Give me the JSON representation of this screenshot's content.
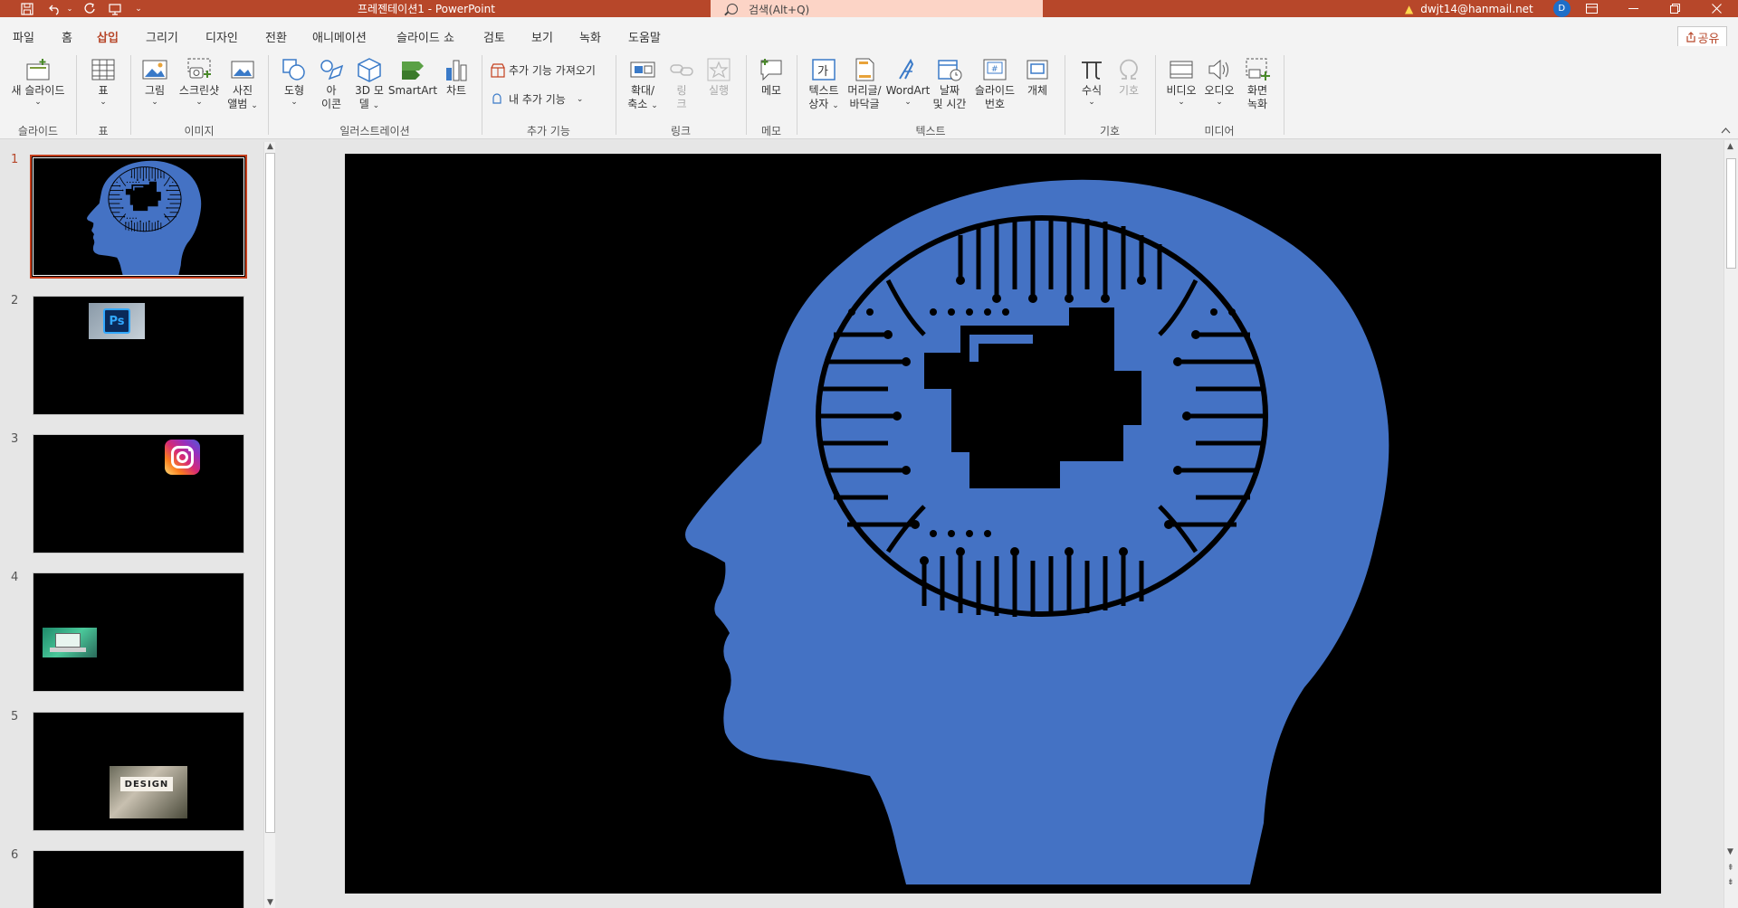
{
  "window": {
    "title": "프레젠테이션1  -  PowerPoint",
    "search_placeholder": "검색(Alt+Q)",
    "user_email": "dwjt14@hanmail.net",
    "avatar_initial": "D",
    "accent_color": "#b7472a"
  },
  "tabs": [
    {
      "label": "파일"
    },
    {
      "label": "홈"
    },
    {
      "label": "삽입",
      "active": true
    },
    {
      "label": "그리기"
    },
    {
      "label": "디자인"
    },
    {
      "label": "전환"
    },
    {
      "label": "애니메이션"
    },
    {
      "label": "슬라이드 쇼"
    },
    {
      "label": "검토"
    },
    {
      "label": "보기"
    },
    {
      "label": "녹화"
    },
    {
      "label": "도움말"
    }
  ],
  "share_label": "공유",
  "ribbon": {
    "groups": {
      "slides": "슬라이드",
      "table": "표",
      "images": "이미지",
      "illustrations": "일러스트레이션",
      "addins": "추가 기능",
      "links": "링크",
      "comments": "메모",
      "text": "텍스트",
      "symbols": "기호",
      "media": "미디어"
    },
    "buttons": {
      "new_slide": "새 슬라이드",
      "table": "표",
      "picture": "그림",
      "screenshot": "스크린샷",
      "photo_album_1": "사진",
      "photo_album_2": "앨범",
      "shapes": "도형",
      "icons_1": "아",
      "icons_2": "이콘",
      "model3d_1": "3D 모",
      "model3d_2": "델",
      "smartart": "SmartArt",
      "chart": "차트",
      "get_addins": "추가 기능 가져오기",
      "my_addins": "내 추가 기능",
      "zoom_1": "확대/",
      "zoom_2": "축소",
      "link_1": "링",
      "link_2": "크",
      "action": "실행",
      "comment": "메모",
      "textbox_1": "텍스트",
      "textbox_2": "상자",
      "header_1": "머리글/",
      "header_2": "바닥글",
      "wordart": "WordArt",
      "datetime_1": "날짜",
      "datetime_2": "및 시간",
      "slidenum_1": "슬라이드",
      "slidenum_2": "번호",
      "object": "개체",
      "equation": "수식",
      "symbol": "기호",
      "video": "비디오",
      "audio": "오디오",
      "screenrec_1": "화면",
      "screenrec_2": "녹화"
    }
  },
  "slides": [
    {
      "num": "1",
      "selected": true,
      "content": "head-circuit"
    },
    {
      "num": "2",
      "content": "photoshop-logo"
    },
    {
      "num": "3",
      "content": "instagram-logo"
    },
    {
      "num": "4",
      "content": "laptop-photo"
    },
    {
      "num": "5",
      "content": "design-photo"
    },
    {
      "num": "6",
      "content": "blank"
    }
  ],
  "thumb_images": {
    "ps_text": "Ps",
    "design_text": "DESIGN"
  },
  "colors": {
    "head_blue": "#4472c4",
    "slide_bg": "#000000"
  }
}
